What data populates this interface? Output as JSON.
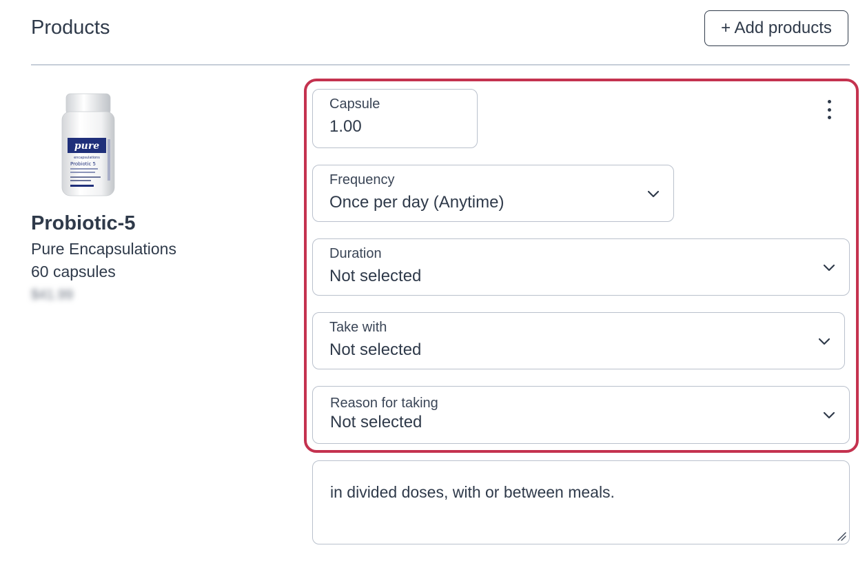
{
  "header": {
    "title": "Products",
    "add_button_label": "+ Add products"
  },
  "product": {
    "name": "Probiotic-5",
    "brand": "Pure Encapsulations",
    "size": "60 capsules",
    "price": "$41.99",
    "image_label": {
      "brand": "pure",
      "subbrand": "encapsulations",
      "product": "Probiotic 5"
    }
  },
  "dosing": {
    "capsule": {
      "label": "Capsule",
      "value": "1.00"
    },
    "frequency": {
      "label": "Frequency",
      "value": "Once per day (Anytime)"
    },
    "duration": {
      "label": "Duration",
      "value": "Not selected"
    },
    "take_with": {
      "label": "Take with",
      "value": "Not selected"
    },
    "reason": {
      "label": "Reason for taking",
      "value": "Not selected"
    }
  },
  "notes": {
    "value": "in divided doses, with or between meals."
  },
  "colors": {
    "highlight": "#c4324f",
    "text": "#2f3a4a",
    "border": "#b9c0cc"
  }
}
